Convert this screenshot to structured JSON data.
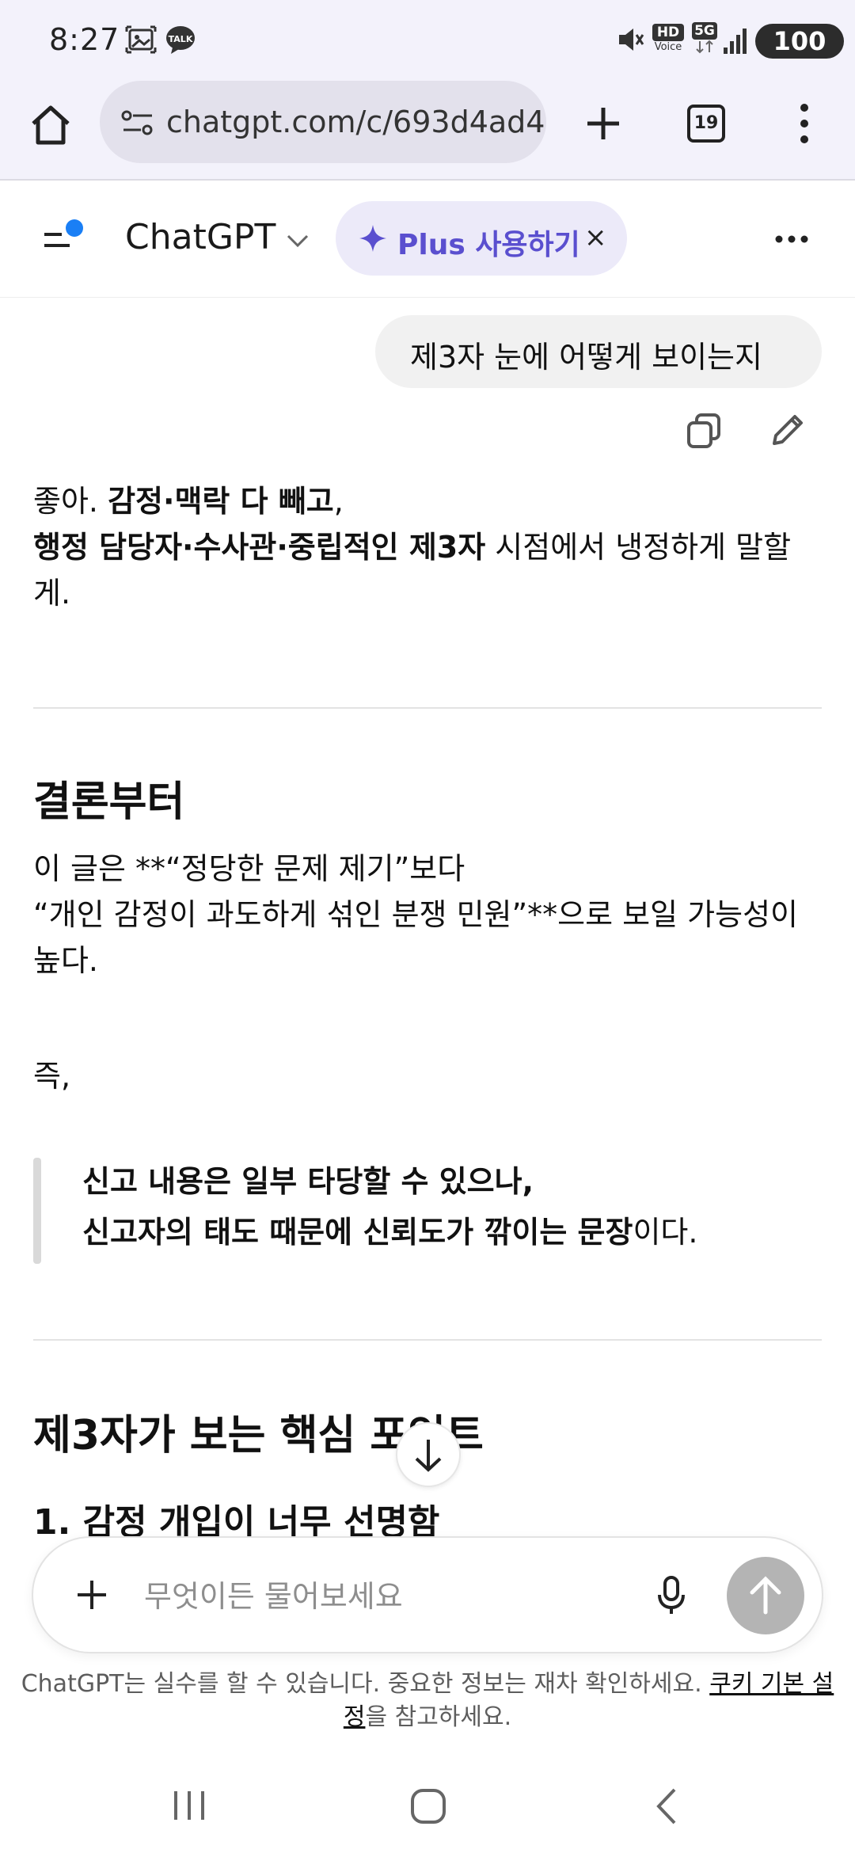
{
  "status_bar": {
    "time": "8:27",
    "hd_label": "HD",
    "voice_label": "Voice",
    "network": "5G",
    "battery": "100",
    "talk_label": "TALK"
  },
  "browser": {
    "url": "chatgpt.com/c/693d4ad4-(",
    "tab_count": "19"
  },
  "header": {
    "title": "ChatGPT",
    "plus_label": "Plus 사용하기",
    "plus_close": "×"
  },
  "chat": {
    "user_message": "제3자 눈에 어떻게 보이는지",
    "intro": {
      "prefix": "좋아. ",
      "bold1": "감정·맥락 다 빼고",
      "comma": ",",
      "bold2": "행정 담당자·수사관·중립적인 제3자",
      "suffix": " 시점에서 냉정하게 말할게."
    },
    "section1_heading": "결론부터",
    "section1_line1": "이 글은 **“정당한 문제 제기”보다",
    "section1_line2": "“개인 감정이 과도하게 섞인 분쟁 민원”**으로 보일 가능성이 높다.",
    "section1_line3": "즉,",
    "quote": {
      "line1": "신고 내용은 일부 타당할 수 있으나,",
      "line2_bold": "신고자의 태도 때문에 신뢰도가 깎이는 문장",
      "line2_rest": "이다."
    },
    "section2_heading": "제3자가 보는 핵심 포인트",
    "section2_sub": "1. 감정 개입이 너무 선명함"
  },
  "composer": {
    "placeholder": "무엇이든 물어보세요"
  },
  "disclaimer": {
    "text": "ChatGPT는 실수를 할 수 있습니다. 중요한 정보는 재차 확인하세요. ",
    "link": "쿠키 기본 설정",
    "suffix": "을 참고하세요."
  }
}
